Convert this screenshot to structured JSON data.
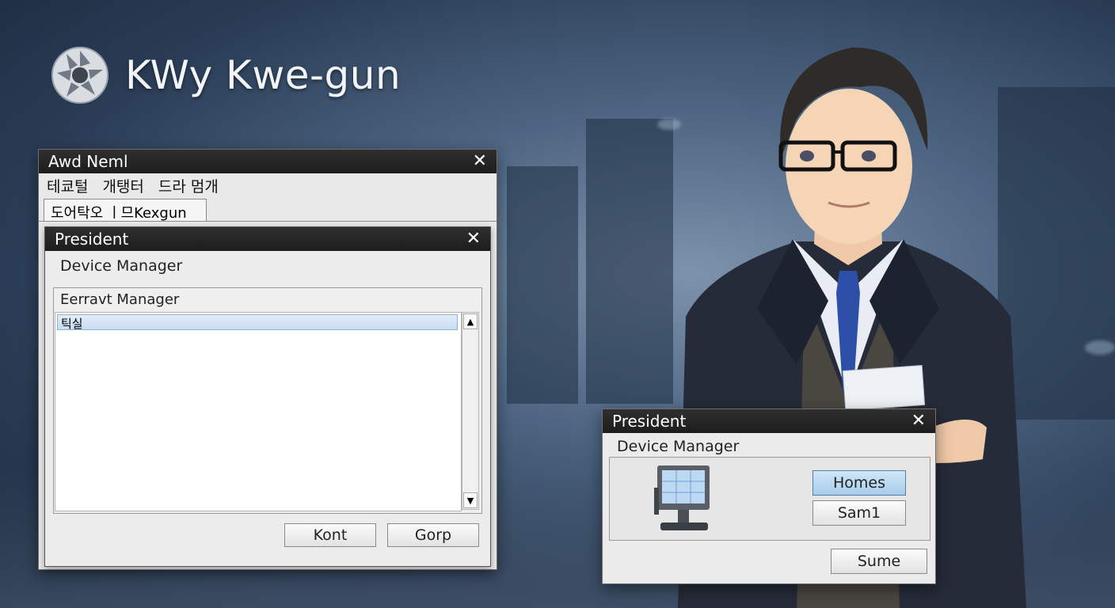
{
  "brand": {
    "title": "KWy Kwe-gun"
  },
  "window_main": {
    "title": "Awd Neml",
    "menu": [
      "테쿄털",
      "개탱터",
      "드라 멈개"
    ],
    "tab": "도어탁오 ㅣ므Kexgun"
  },
  "window_inner": {
    "title": "President",
    "subtitle": "Device Manager",
    "group_label": "Eerravt Manager",
    "list_items": [
      "틱실"
    ],
    "buttons": {
      "ok": "Kont",
      "cancel": "Gorp"
    }
  },
  "window_small": {
    "title": "President",
    "subtitle": "Device Manager",
    "buttons": {
      "homes": "Homes",
      "sam": "Sam1",
      "sume": "Sume"
    }
  },
  "icons": {
    "close": "✕",
    "scroll_up": "▲",
    "scroll_down": "▼",
    "logo": "aperture-logo-icon",
    "monitor": "computer-monitor-icon"
  },
  "colors": {
    "titlebar": "#1d1d1d",
    "selection": "#c8dcf1",
    "accent_button": "#a8cdea"
  }
}
